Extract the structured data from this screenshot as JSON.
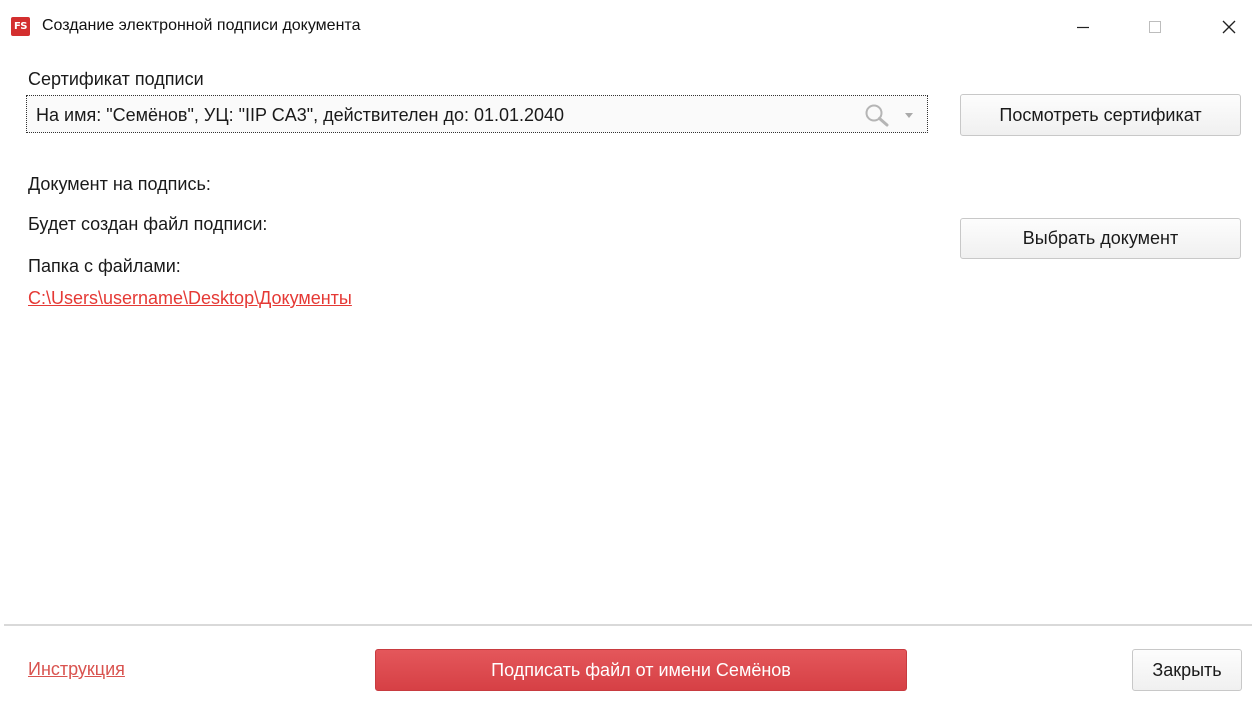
{
  "window": {
    "logo_text": "FS",
    "title": "Создание электронной подписи документа"
  },
  "certificate": {
    "label": "Сертификат подписи",
    "selected_value": "На имя: \"Семёнов\", УЦ: \"IIP CA3\", действителен до: 01.01.2040",
    "view_button": "Посмотреть сертификат"
  },
  "document": {
    "doc_label": "Документ на подпись:",
    "signature_file_label": "Будет создан файл подписи:",
    "choose_button": "Выбрать документ",
    "folder_label": "Папка с файлами:",
    "folder_path": "C:\\Users\\username\\Desktop\\Документы"
  },
  "footer": {
    "instruction_link": "Инструкция",
    "sign_button": "Подписать файл от имени Семёнов",
    "close_button": "Закрыть"
  },
  "colors": {
    "accent": "#d64045",
    "link": "#e53935"
  }
}
